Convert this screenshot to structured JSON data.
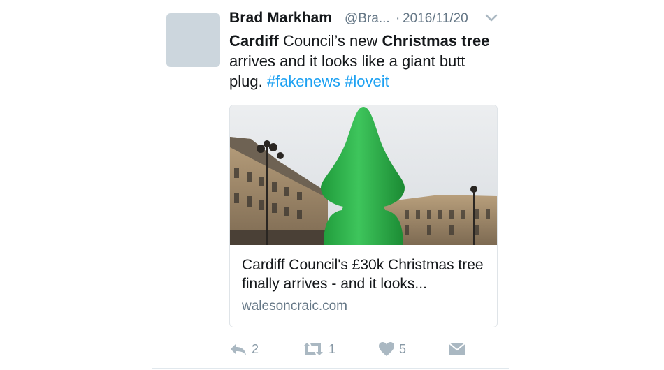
{
  "tweet": {
    "author_name": "Brad Markham",
    "handle": "@Bra...",
    "separator": "·",
    "date": "2016/11/20",
    "text": {
      "p1": "Cardiff",
      "p2": " Council’s new ",
      "p3": "Christmas tree",
      "p4": " arrives and it looks like a giant butt plug. ",
      "tag1": "#fakenews",
      "space": " ",
      "tag2": "#loveit"
    }
  },
  "card": {
    "title": "Cardiff Council's £30k Christmas tree finally arrives - and it looks...",
    "domain": "walesoncraic.com"
  },
  "actions": {
    "reply_count": "2",
    "retweet_count": "1",
    "like_count": "5"
  },
  "icons": {
    "menu": "chevron-down-icon",
    "reply": "reply-icon",
    "retweet": "retweet-icon",
    "like": "heart-icon",
    "dm": "envelope-icon"
  },
  "colors": {
    "link": "#1da1f2",
    "secondary_text": "#657786",
    "action_icons": "#aab8c2"
  }
}
